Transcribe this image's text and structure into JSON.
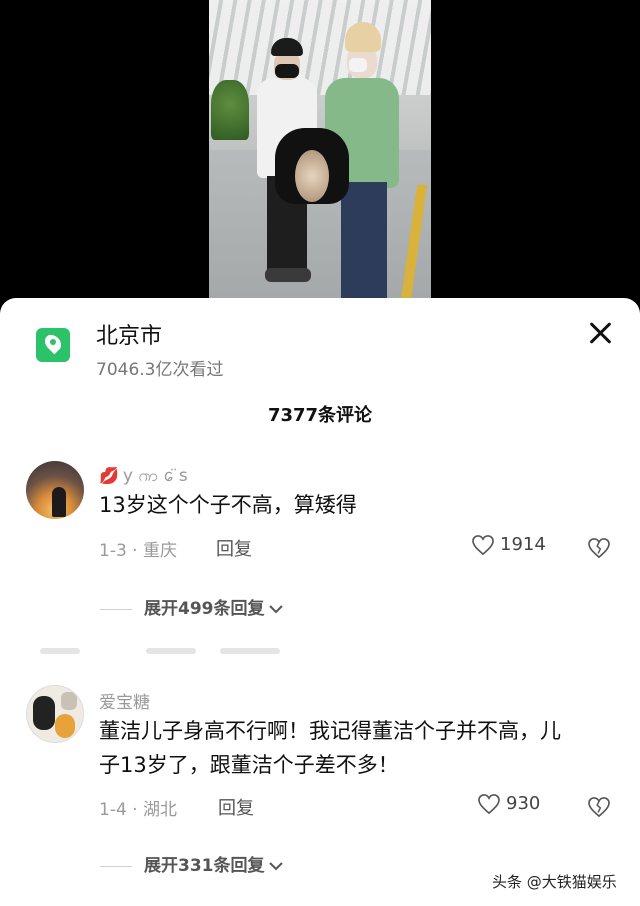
{
  "location": {
    "name": "北京市",
    "views": "7046.3亿次看过"
  },
  "comments_count": "7377条评论",
  "comments": [
    {
      "user": "y ၮ ᩮ̈ s",
      "text": "13岁这个个子不高，算矮得",
      "date_place": "1-3 · 重庆",
      "reply_label": "回复",
      "likes": "1914",
      "expand": "展开499条回复"
    },
    {
      "user": "爱宝糖",
      "text": "董洁儿子身高不行啊！我记得董洁个子并不高，儿子13岁了，跟董洁个子差不多！",
      "date_place": "1-4 · 湖北",
      "reply_label": "回复",
      "likes": "930",
      "expand": "展开331条回复"
    }
  ],
  "watermark": "头条 @大铁猫娱乐",
  "colors": {
    "accent_green": "#2bc26a",
    "lips_red": "#d0143a"
  },
  "icons": [
    "location-pin-icon",
    "close-icon",
    "heart-icon",
    "broken-heart-icon",
    "chevron-down-icon"
  ]
}
